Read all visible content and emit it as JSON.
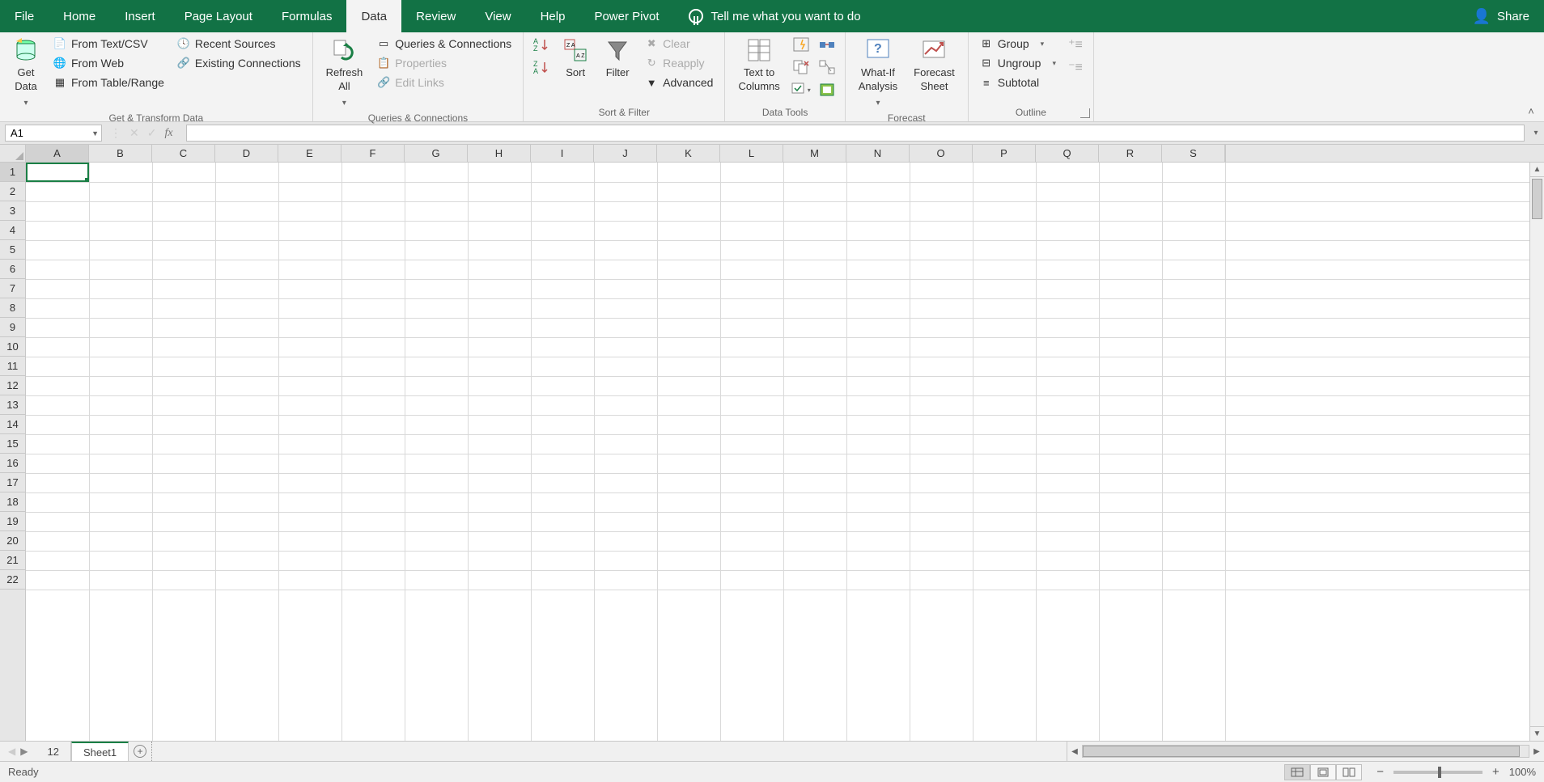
{
  "tabs": {
    "file": "File",
    "home": "Home",
    "insert": "Insert",
    "pagelayout": "Page Layout",
    "formulas": "Formulas",
    "data": "Data",
    "review": "Review",
    "view": "View",
    "help": "Help",
    "powerpivot": "Power Pivot",
    "tellme": "Tell me what you want to do",
    "share": "Share"
  },
  "ribbon": {
    "get_data": "Get\nData",
    "from_textcsv": "From Text/CSV",
    "from_web": "From Web",
    "from_tablerange": "From Table/Range",
    "recent_sources": "Recent Sources",
    "existing_connections": "Existing Connections",
    "group_transform": "Get & Transform Data",
    "refresh_all": "Refresh\nAll",
    "queries_connections": "Queries & Connections",
    "properties": "Properties",
    "edit_links": "Edit Links",
    "group_queries": "Queries & Connections",
    "sort": "Sort",
    "filter": "Filter",
    "clear": "Clear",
    "reapply": "Reapply",
    "advanced": "Advanced",
    "group_sortfilter": "Sort & Filter",
    "text_to_columns": "Text to\nColumns",
    "group_datatools": "Data Tools",
    "whatif": "What-If\nAnalysis",
    "forecast_sheet": "Forecast\nSheet",
    "group_forecast": "Forecast",
    "grp": "Group",
    "ungrp": "Ungroup",
    "subtotal": "Subtotal",
    "group_outline": "Outline"
  },
  "formula_bar": {
    "name_box": "A1",
    "formula": ""
  },
  "columns": [
    "A",
    "B",
    "C",
    "D",
    "E",
    "F",
    "G",
    "H",
    "I",
    "J",
    "K",
    "L",
    "M",
    "N",
    "O",
    "P",
    "Q",
    "R",
    "S"
  ],
  "rows": [
    "1",
    "2",
    "3",
    "4",
    "5",
    "6",
    "7",
    "8",
    "9",
    "10",
    "11",
    "12",
    "13",
    "14",
    "15",
    "16",
    "17",
    "18",
    "19",
    "20",
    "21",
    "22"
  ],
  "sheets": {
    "tab1": "12",
    "tab2": "Sheet1"
  },
  "status": {
    "ready": "Ready",
    "zoom": "100%"
  }
}
